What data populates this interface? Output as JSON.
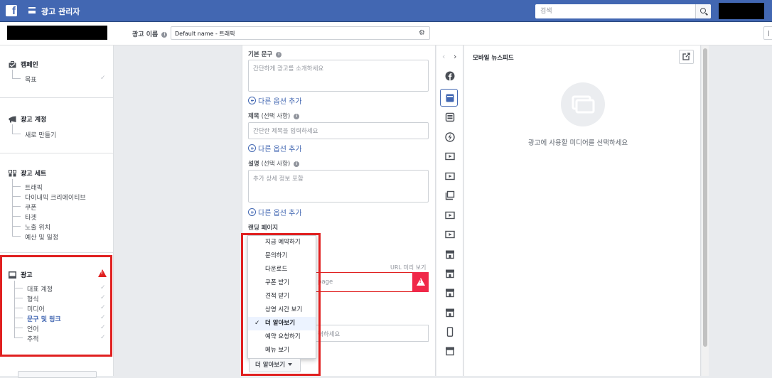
{
  "app": {
    "title": "광고 관리자"
  },
  "search": {
    "placeholder": "검색"
  },
  "ad_name": {
    "label": "광고 이름",
    "value": "Default name - 트래픽"
  },
  "sidebar": {
    "campaign": {
      "title": "캠페인",
      "items": [
        "목표"
      ]
    },
    "account": {
      "title": "광고 계정",
      "items": [
        "새로 만들기"
      ]
    },
    "adset": {
      "title": "광고 세트",
      "items": [
        "트래픽",
        "다이내믹 크리에이티브",
        "쿠폰",
        "타겟",
        "노출 위치",
        "예산 및 일정"
      ]
    },
    "ad": {
      "title": "광고",
      "items": [
        "대표 계정",
        "형식",
        "미디어",
        "문구 및 링크",
        "언어",
        "추적"
      ],
      "active_item": "문구 및 링크"
    }
  },
  "form": {
    "primary_text": {
      "label": "기본 문구",
      "placeholder": "간단하게 광고를 소개하세요"
    },
    "add_option": "다른 옵션 추가",
    "headline": {
      "label": "제목",
      "optional": "(선택 사항)",
      "placeholder": "간단한 제목을 입력하세요"
    },
    "description": {
      "label": "설명",
      "optional": "(선택 사항)",
      "placeholder": "추가 상세 정보 포함"
    },
    "landing_page": {
      "label": "랜딩 페이지"
    },
    "url_preview": "URL 미리 보기",
    "url_partial": "page",
    "bottom_partial": "력하세요",
    "cta_options": [
      "지금 예약하기",
      "문의하기",
      "다운로드",
      "쿠폰 받기",
      "견적 받기",
      "상영 시간 보기",
      "더 알아보기",
      "예약 요청하기",
      "메뉴 보기"
    ],
    "cta_selected": "더 알아보기",
    "cta_button": "더 알아보기"
  },
  "preview": {
    "title": "모바일 뉴스피드",
    "empty_message": "광고에 사용할 미디어를 선택하세요"
  },
  "colors": {
    "brand": "#4267b2",
    "error": "#e02020",
    "warning": "#f02849"
  }
}
